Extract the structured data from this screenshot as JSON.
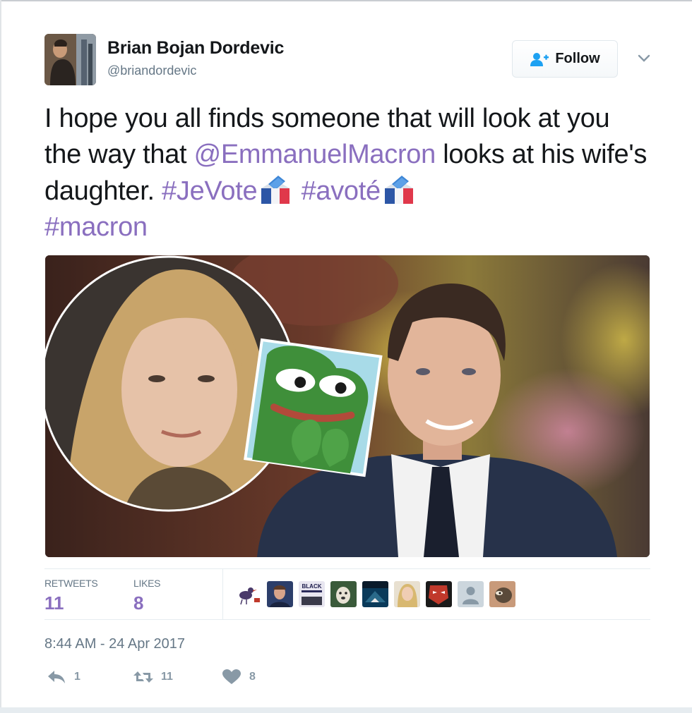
{
  "author": {
    "name": "Brian Bojan Dordevic",
    "handle": "@briandordevic",
    "avatar_icon": "profile-photo"
  },
  "follow_button": {
    "label": "Follow",
    "icon": "add-user-icon"
  },
  "more_menu_icon": "chevron-down-icon",
  "tweet": {
    "text_before_mention": "I hope you all finds someone that will look at you the way that ",
    "mention": "@EmmanuelMacron",
    "text_after_mention": " looks at his wife's daughter. ",
    "hashtag_1": "#JeVote",
    "hashtag_2": "#avoté",
    "hashtag_3": "#macron",
    "emoji": "ballot-box-emoji",
    "link_color": "#8a6fbf"
  },
  "media": {
    "description_icon": "attached-photo"
  },
  "stats": {
    "retweets_label": "RETWEETS",
    "retweets_count": "11",
    "likes_label": "LIKES",
    "likes_count": "8",
    "likers": [
      {
        "icon": "bird-avatar"
      },
      {
        "icon": "face-avatar"
      },
      {
        "icon": "black-text-avatar",
        "text": "BLACK"
      },
      {
        "icon": "dog-avatar"
      },
      {
        "icon": "shark-avatar"
      },
      {
        "icon": "woman-avatar"
      },
      {
        "icon": "red-mask-avatar"
      },
      {
        "icon": "default-avatar"
      },
      {
        "icon": "pepe-avatar"
      }
    ]
  },
  "timestamp": "8:44 AM - 24 Apr 2017",
  "actions": {
    "reply_count": "1",
    "retweet_count": "11",
    "like_count": "8"
  }
}
